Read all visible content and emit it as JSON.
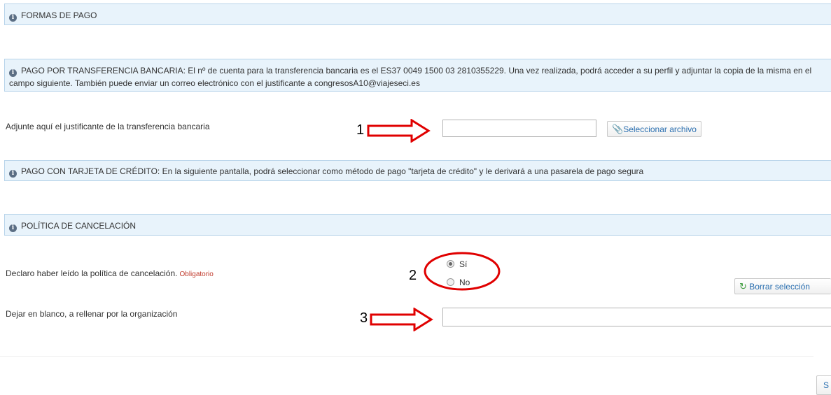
{
  "sections": {
    "formas_pago": "FORMAS DE PAGO",
    "transferencia": "PAGO POR TRANSFERENCIA BANCARIA: El nº de cuenta para la transferencia bancaria es el ES37 0049 1500 03 2810355229. Una vez realizada, podrá acceder a su perfil y adjuntar la copia de la misma en el campo siguiente. También puede enviar un correo electrónico con el justificante a congresosA10@viajeseci.es",
    "tarjeta": "PAGO CON TARJETA DE CRÉDITO: En la siguiente pantalla, podrá seleccionar como método de pago \"tarjeta de crédito\" y le derivará a una pasarela de pago segura",
    "cancelacion": "POLÍTICA DE CANCELACIÓN"
  },
  "fields": {
    "justificante_label": "Adjunte aquí el justificante de la transferencia bancaria",
    "file_input_value": "",
    "select_file_label": "Seleccionar archivo",
    "declaro_label": "Declaro haber leído la política de cancelación.",
    "required_label": "Obligatorio",
    "radio_yes": "Sí",
    "radio_no": "No",
    "radio_selected": "Sí",
    "clear_selection_label": "Borrar selección",
    "blank_label": "Dejar en blanco, a rellenar por la organización",
    "blank_input_value": "",
    "bottom_button_label": "S"
  },
  "annotations": {
    "n1": "1",
    "n2": "2",
    "n3": "3",
    "color": "#e00000"
  },
  "icons": [
    "info-icon",
    "paperclip-icon",
    "refresh-icon"
  ]
}
